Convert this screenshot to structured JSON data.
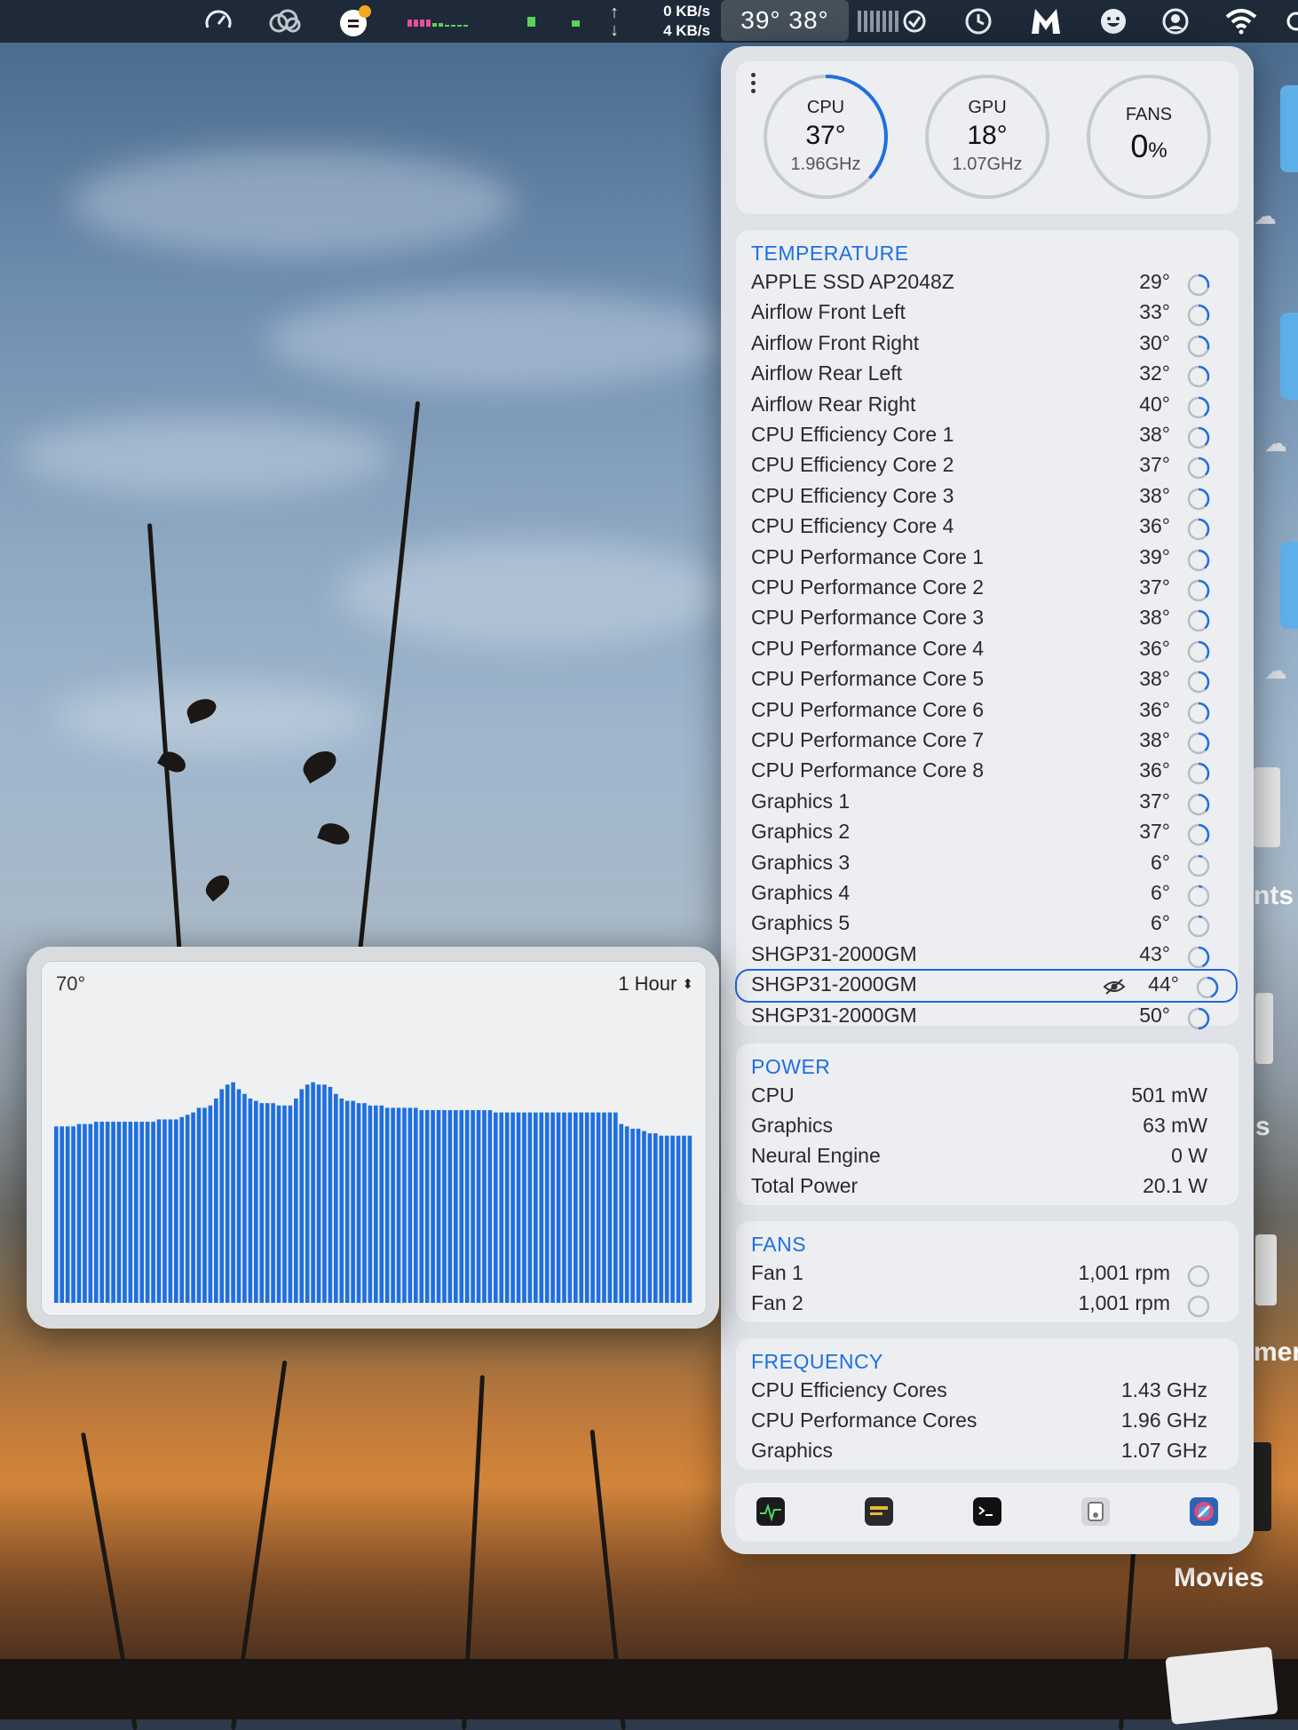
{
  "menubar": {
    "net_up": "0 KB/s",
    "net_down": "4 KB/s",
    "temps_label": "39° 38°",
    "icons": [
      "speedometer-icon",
      "creative-cloud-icon",
      "weather-icon",
      "cpu-bars-icon",
      "memory-icon",
      "network-arrows-icon",
      "checklist-icon",
      "time-machine-icon",
      "malwarebytes-icon",
      "emoji-icon",
      "user-icon",
      "wifi-icon"
    ]
  },
  "gauges": {
    "cpu": {
      "label": "CPU",
      "value": "37°",
      "sub": "1.96GHz",
      "fill": 0.37
    },
    "gpu": {
      "label": "GPU",
      "value": "18°",
      "sub": "1.07GHz",
      "fill": 0.0
    },
    "fans": {
      "label": "FANS",
      "value": "0",
      "unit": "%",
      "fill": 0.0
    }
  },
  "temperature": {
    "title": "TEMPERATURE",
    "rows": [
      {
        "name": "APPLE SSD AP2048Z",
        "value": "29°",
        "fill": 0.29
      },
      {
        "name": "Airflow Front Left",
        "value": "33°",
        "fill": 0.33
      },
      {
        "name": "Airflow Front Right",
        "value": "30°",
        "fill": 0.3
      },
      {
        "name": "Airflow Rear Left",
        "value": "32°",
        "fill": 0.32
      },
      {
        "name": "Airflow Rear Right",
        "value": "40°",
        "fill": 0.4
      },
      {
        "name": "CPU Efficiency Core 1",
        "value": "38°",
        "fill": 0.38
      },
      {
        "name": "CPU Efficiency Core 2",
        "value": "37°",
        "fill": 0.37
      },
      {
        "name": "CPU Efficiency Core 3",
        "value": "38°",
        "fill": 0.38
      },
      {
        "name": "CPU Efficiency Core 4",
        "value": "36°",
        "fill": 0.36
      },
      {
        "name": "CPU Performance Core 1",
        "value": "39°",
        "fill": 0.39
      },
      {
        "name": "CPU Performance Core 2",
        "value": "37°",
        "fill": 0.37
      },
      {
        "name": "CPU Performance Core 3",
        "value": "38°",
        "fill": 0.38
      },
      {
        "name": "CPU Performance Core 4",
        "value": "36°",
        "fill": 0.36
      },
      {
        "name": "CPU Performance Core 5",
        "value": "38°",
        "fill": 0.38
      },
      {
        "name": "CPU Performance Core 6",
        "value": "36°",
        "fill": 0.36
      },
      {
        "name": "CPU Performance Core 7",
        "value": "38°",
        "fill": 0.38
      },
      {
        "name": "CPU Performance Core 8",
        "value": "36°",
        "fill": 0.36
      },
      {
        "name": "Graphics 1",
        "value": "37°",
        "fill": 0.37
      },
      {
        "name": "Graphics 2",
        "value": "37°",
        "fill": 0.37
      },
      {
        "name": "Graphics 3",
        "value": "6°",
        "fill": 0.06
      },
      {
        "name": "Graphics 4",
        "value": "6°",
        "fill": 0.06
      },
      {
        "name": "Graphics 5",
        "value": "6°",
        "fill": 0.06
      },
      {
        "name": "SHGP31-2000GM",
        "value": "43°",
        "fill": 0.43
      },
      {
        "name": "SHGP31-2000GM",
        "value": "44°",
        "fill": 0.44,
        "selected": true
      },
      {
        "name": "SHGP31-2000GM",
        "value": "50°",
        "fill": 0.5
      }
    ]
  },
  "power": {
    "title": "POWER",
    "rows": [
      {
        "name": "CPU",
        "value": "501 mW"
      },
      {
        "name": "Graphics",
        "value": "63 mW"
      },
      {
        "name": "Neural Engine",
        "value": "0 W"
      },
      {
        "name": "Total Power",
        "value": "20.1 W"
      }
    ]
  },
  "fans": {
    "title": "FANS",
    "rows": [
      {
        "name": "Fan 1",
        "value": "1,001 rpm",
        "fill": 0.0
      },
      {
        "name": "Fan 2",
        "value": "1,001 rpm",
        "fill": 0.0
      }
    ]
  },
  "frequency": {
    "title": "FREQUENCY",
    "rows": [
      {
        "name": "CPU Efficiency Cores",
        "value": "1.43 GHz"
      },
      {
        "name": "CPU Performance Cores",
        "value": "1.96 GHz"
      },
      {
        "name": "Graphics",
        "value": "1.07 GHz"
      }
    ]
  },
  "dock_apps": [
    "activity-monitor-icon",
    "console-icon",
    "terminal-icon",
    "system-information-icon",
    "disk-utility-icon"
  ],
  "desktop_labels": {
    "partial_1": "nts",
    "partial_2": "s",
    "partial_3": "mer",
    "movies": "Movies"
  },
  "chart_data": {
    "type": "bar",
    "max_label": "70°",
    "range_label": "1 Hour",
    "range_control_icon": "up-down-chevron-icon",
    "color": "#1f6fe0",
    "ylim": [
      0,
      70
    ],
    "values": [
      38,
      38,
      38,
      38,
      38.5,
      38.5,
      38.5,
      39,
      39,
      39,
      39,
      39,
      39,
      39,
      39,
      39,
      39,
      39,
      39.5,
      39.5,
      39.5,
      39.5,
      40,
      40.5,
      41,
      42,
      42,
      42.5,
      44,
      46,
      47,
      47.5,
      46,
      45,
      44,
      43.5,
      43,
      43,
      43,
      42.5,
      42.5,
      42.5,
      44,
      46,
      47,
      47.5,
      47,
      47,
      46.5,
      45,
      44,
      43.5,
      43.5,
      43,
      43,
      42.5,
      42.5,
      42.5,
      42,
      42,
      42,
      42,
      42,
      42,
      41.5,
      41.5,
      41.5,
      41.5,
      41.5,
      41.5,
      41.5,
      41.5,
      41.5,
      41.5,
      41.5,
      41.5,
      41.5,
      41,
      41,
      41,
      41,
      41,
      41,
      41,
      41,
      41,
      41,
      41,
      41,
      41,
      41,
      41,
      41,
      41,
      41,
      41,
      41,
      41,
      41,
      38.5,
      38,
      37.5,
      37.5,
      37,
      36.5,
      36.5,
      36,
      36,
      36,
      36,
      36,
      36
    ]
  }
}
